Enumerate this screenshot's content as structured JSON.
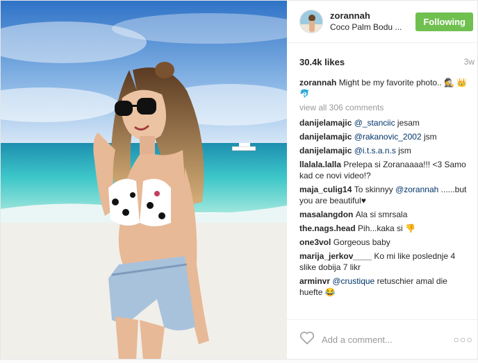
{
  "header": {
    "username": "zorannah",
    "location": "Coco Palm Bodu ...",
    "follow_label": "Following",
    "follow_color": "#70c050"
  },
  "meta": {
    "likes": "30.4k likes",
    "time": "3w"
  },
  "caption": {
    "author": "zorannah",
    "text": "Might be my favorite photo.. 🕵 👑🐬"
  },
  "view_all": "view all 306 comments",
  "comments": [
    {
      "author": "danijelamajic",
      "segments": [
        {
          "t": "@_stanciic",
          "m": true
        },
        {
          "t": " jesam",
          "m": false
        }
      ]
    },
    {
      "author": "danijelamajic",
      "segments": [
        {
          "t": "@rakanovic_2002",
          "m": true
        },
        {
          "t": " jsm",
          "m": false
        }
      ]
    },
    {
      "author": "danijelamajic",
      "segments": [
        {
          "t": "@i.t.s.a.n.s",
          "m": true
        },
        {
          "t": " jsm",
          "m": false
        }
      ]
    },
    {
      "author": "llalala.lalla",
      "segments": [
        {
          "t": "Prelepa si Zoranaaaa!!! <3 Samo kad ce novi video!?",
          "m": false
        }
      ]
    },
    {
      "author": "maja_culig14",
      "segments": [
        {
          "t": "To skinnyy ",
          "m": false
        },
        {
          "t": "@zorannah",
          "m": true
        },
        {
          "t": " ......but you are beautiful♥",
          "m": false
        }
      ]
    },
    {
      "author": "masalangdon",
      "segments": [
        {
          "t": "Ala si smrsala",
          "m": false
        }
      ]
    },
    {
      "author": "the.nags.head",
      "segments": [
        {
          "t": "Pih...kaka si 👎",
          "m": false
        }
      ]
    },
    {
      "author": "one3vol",
      "segments": [
        {
          "t": "Gorgeous baby",
          "m": false
        }
      ]
    },
    {
      "author": "marija_jerkov____",
      "segments": [
        {
          "t": "Ko mi like poslednje 4 slike dobija 7 likr",
          "m": false
        }
      ]
    },
    {
      "author": "arminvr",
      "segments": [
        {
          "t": "@crustique",
          "m": true
        },
        {
          "t": " retuschier amal die huefte 😂",
          "m": false
        }
      ]
    }
  ],
  "footer": {
    "heart_icon": "heart-outline-icon",
    "comment_placeholder": "Add a comment...",
    "more_icon": "more-options-icon",
    "more_glyph": "○○○"
  }
}
